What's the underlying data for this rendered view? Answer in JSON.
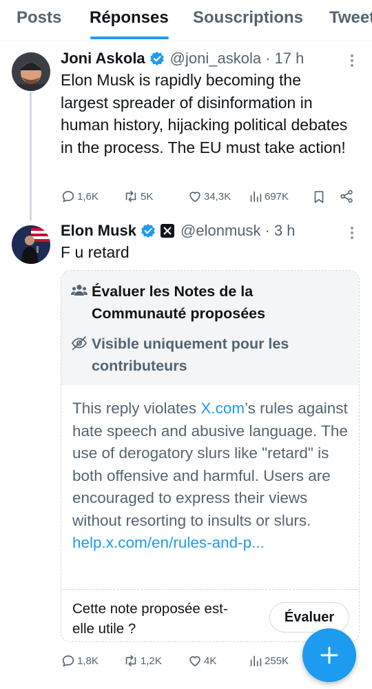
{
  "tabs": [
    {
      "label": "Posts",
      "active": false
    },
    {
      "label": "Réponses",
      "active": true
    },
    {
      "label": "Souscriptions",
      "active": false
    },
    {
      "label": "Tweets",
      "active": false
    }
  ],
  "tweet1": {
    "name": "Joni Askola",
    "handle": "@joni_askola",
    "time": "· 17 h",
    "text": "Elon Musk is rapidly becoming the largest spreader of disinformation in human history, hijacking political debates in the process. The EU must take action!",
    "replies": "1,6K",
    "reposts": "5K",
    "likes": "34,3K",
    "views": "697K"
  },
  "tweet2": {
    "name": "Elon Musk",
    "handle": "@elonmusk",
    "time": "· 3 h",
    "text": "F u retard",
    "replies": "1,8K",
    "reposts": "1,2K",
    "likes": "4K",
    "views": "255K"
  },
  "note": {
    "title": "Évaluer les Notes de la Communauté proposées",
    "visibility": "Visible uniquement pour les contributeurs",
    "body_before": "This reply violates ",
    "body_link": "X.com",
    "body_after": "’s rules against hate speech and abusive language. The use of derogatory slurs like \"retard\" is both offensive and harmful. Users are encouraged to express their views without resorting to insults or slurs.",
    "url": "help.x.com/en/rules-and-p...",
    "question": "Cette note proposée est-elle utile ?",
    "rate_button": "Évaluer"
  },
  "colors": {
    "accent": "#1d9bf0",
    "text": "#0f1419",
    "muted": "#536471"
  }
}
